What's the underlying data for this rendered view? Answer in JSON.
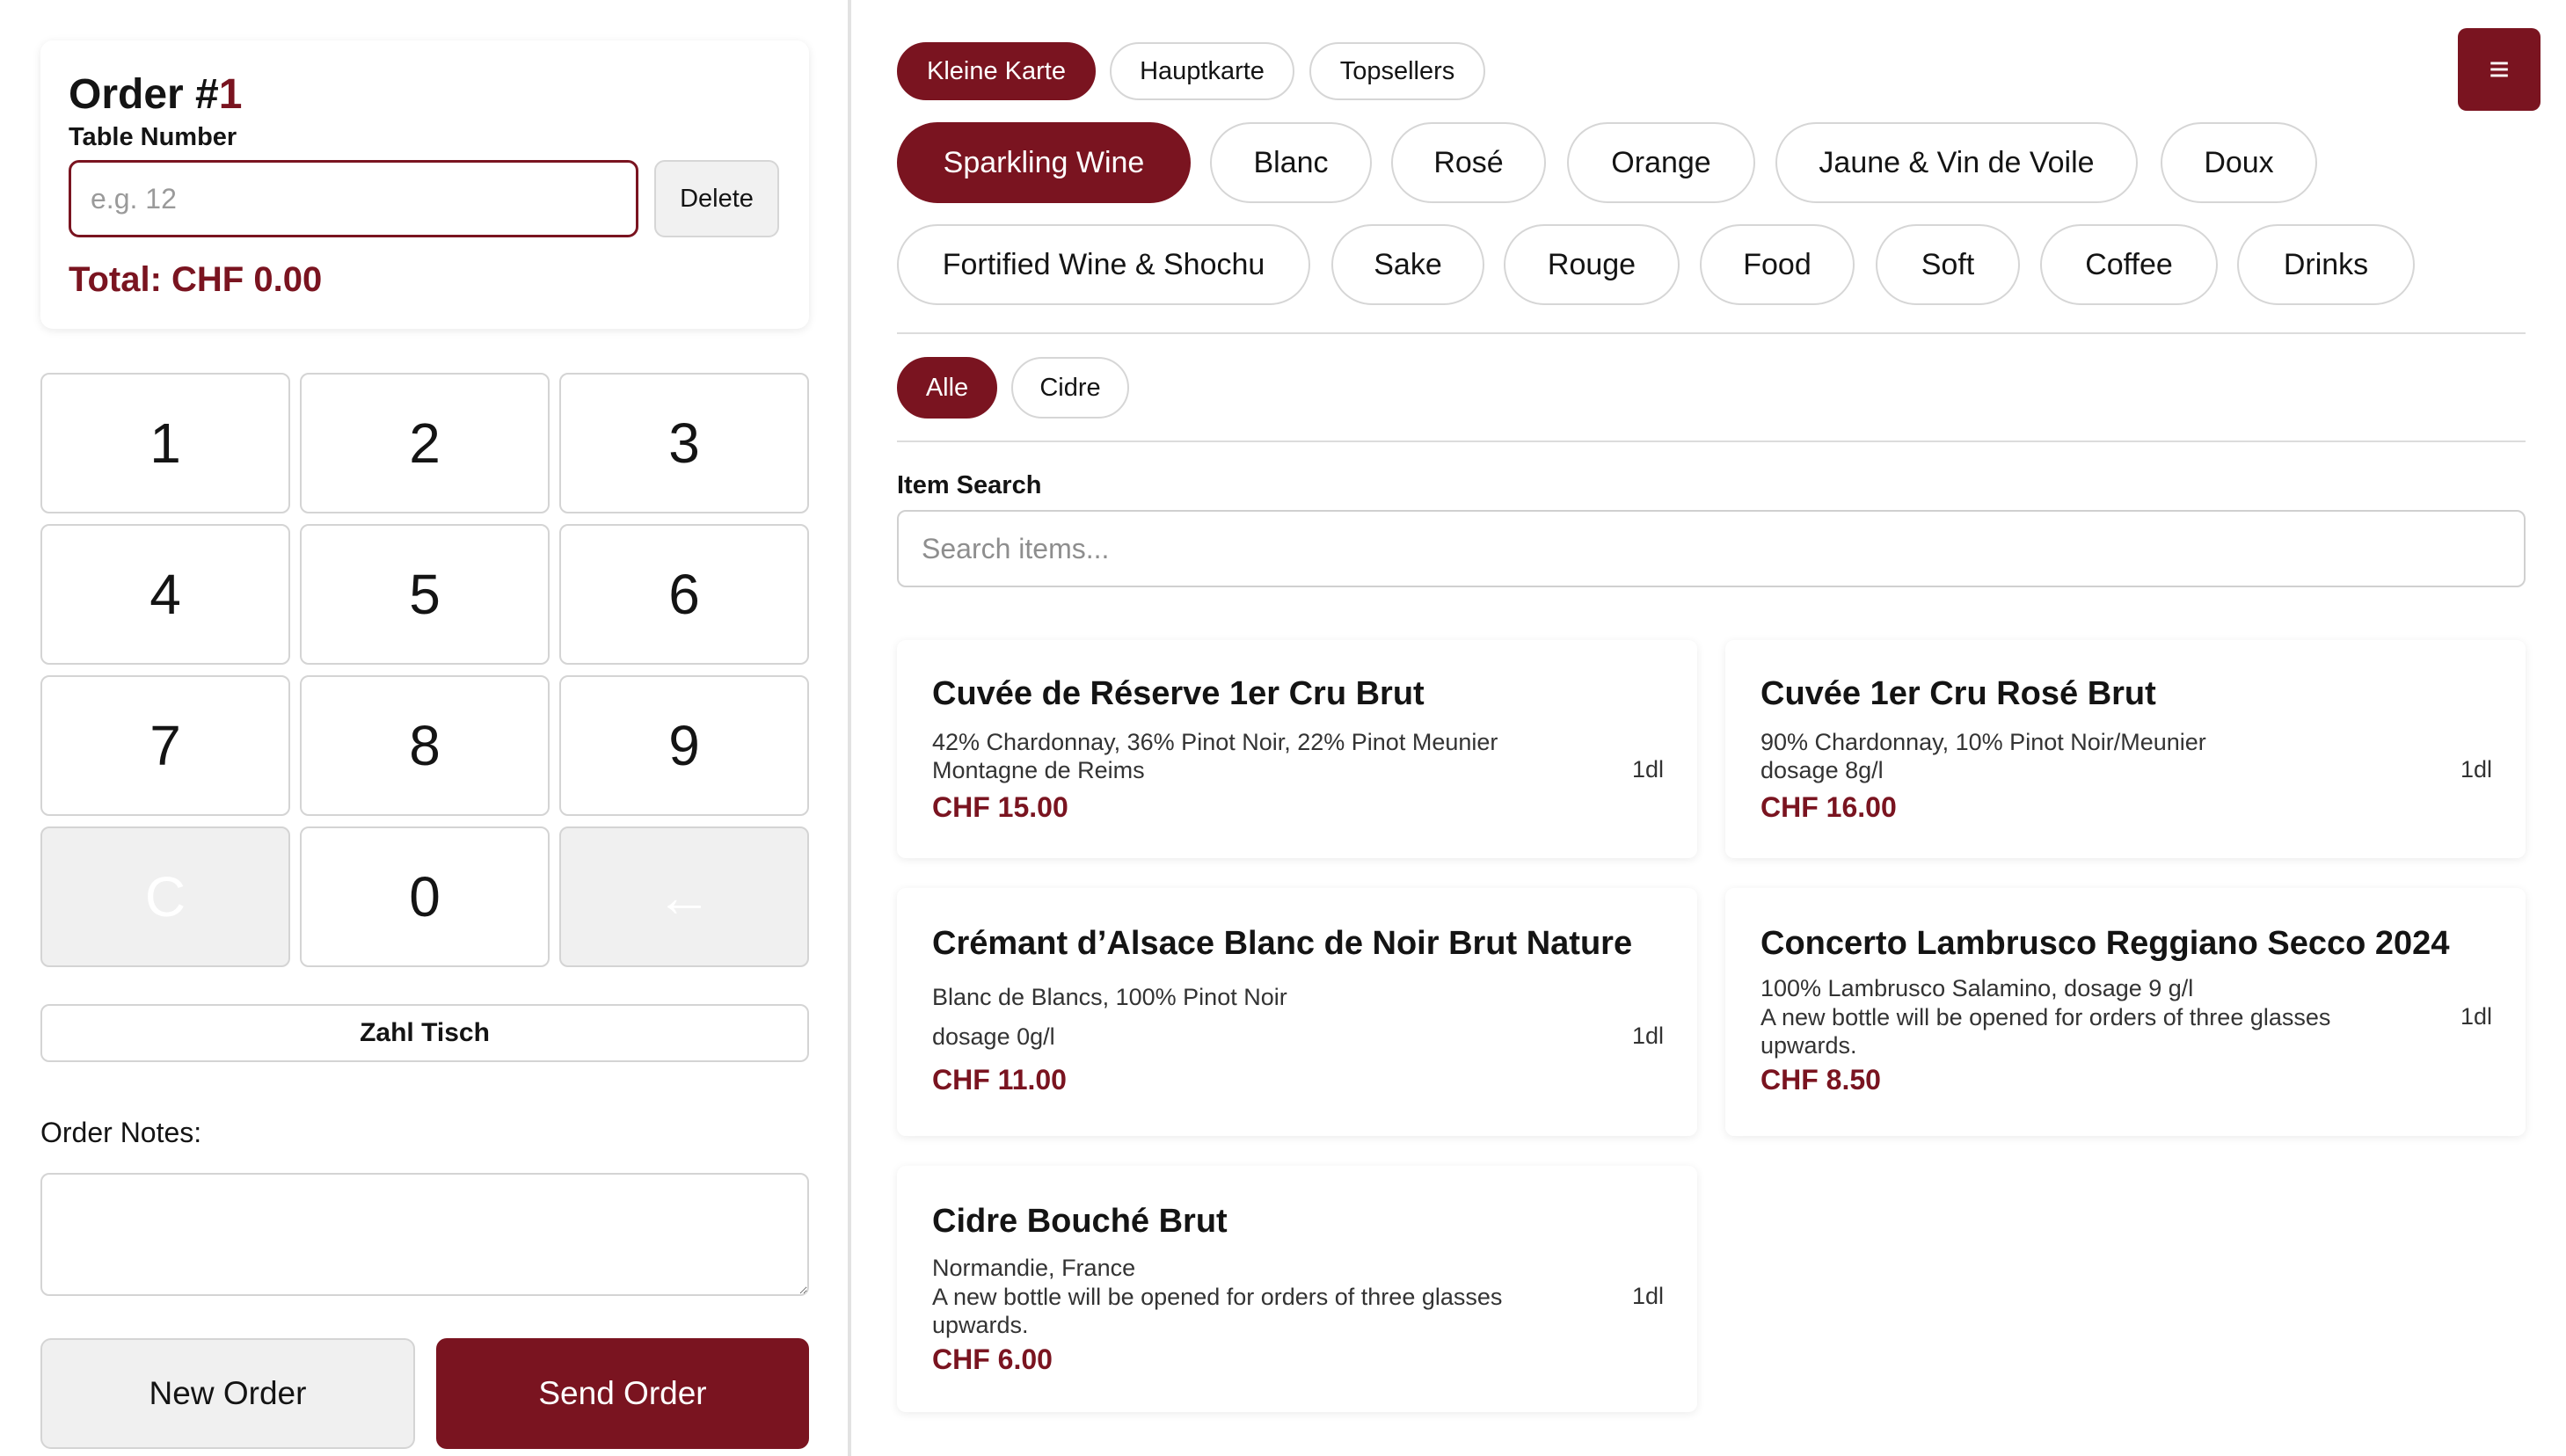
{
  "order": {
    "title_prefix": "Order #",
    "number": "1",
    "table_label": "Table Number",
    "table_placeholder": "e.g. 12",
    "table_value": "",
    "delete_label": "Delete",
    "total": "Total: CHF 0.00"
  },
  "keypad": {
    "keys": [
      "1",
      "2",
      "3",
      "4",
      "5",
      "6",
      "7",
      "8",
      "9",
      "C",
      "0",
      "←"
    ]
  },
  "zahl_tisch_label": "Zahl Tisch",
  "notes": {
    "label": "Order Notes:",
    "value": ""
  },
  "actions": {
    "new_order": "New Order",
    "send_order": "Send Order"
  },
  "menu_icon": "≡",
  "menus": {
    "tabs": [
      "Kleine Karte",
      "Hauptkarte",
      "Topsellers"
    ],
    "active": "Kleine Karte"
  },
  "categories": {
    "items": [
      "Sparkling Wine",
      "Blanc",
      "Rosé",
      "Orange",
      "Jaune & Vin de Voile",
      "Doux",
      "Fortified Wine & Shochu",
      "Sake",
      "Rouge",
      "Food",
      "Soft",
      "Coffee",
      "Drinks"
    ],
    "active": "Sparkling Wine"
  },
  "subcategories": {
    "items": [
      "Alle",
      "Cidre"
    ],
    "active": "Alle"
  },
  "search": {
    "label": "Item Search",
    "placeholder": "Search items...",
    "value": ""
  },
  "items": [
    {
      "name": "Cuvée de Réserve 1er Cru Brut",
      "line1": "42% Chardonnay, 36% Pinot Noir, 22% Pinot Meunier",
      "line2": "Montagne de Reims",
      "line3": "",
      "size": "1dl",
      "price": "CHF 15.00"
    },
    {
      "name": "Cuvée 1er Cru Rosé Brut",
      "line1": "90% Chardonnay, 10% Pinot Noir/Meunier",
      "line2": "dosage 8g/l",
      "line3": "",
      "size": "1dl",
      "price": "CHF 16.00"
    },
    {
      "name": "Crémant d’Alsace Blanc de Noir Brut Nature",
      "line1": "Blanc de Blancs, 100% Pinot Noir",
      "line2": "dosage 0g/l",
      "line3": "",
      "size": "1dl",
      "price": "CHF 11.00"
    },
    {
      "name": "Concerto Lambrusco Reggiano Secco 2024",
      "line1": "100% Lambrusco Salamino, dosage 9 g/l",
      "line2": "A new bottle will be opened for orders of three glasses",
      "line3": "upwards.",
      "size": "1dl",
      "price": "CHF 8.50"
    },
    {
      "name": "Cidre Bouché Brut",
      "line1": "Normandie, France",
      "line2": "A new bottle will be opened for orders of three glasses",
      "line3": "upwards.",
      "size": "1dl",
      "price": "CHF 6.00"
    }
  ],
  "colors": {
    "accent": "#7a1420",
    "muted_button": "#f0f0f0",
    "border": "#d4d4d4"
  }
}
